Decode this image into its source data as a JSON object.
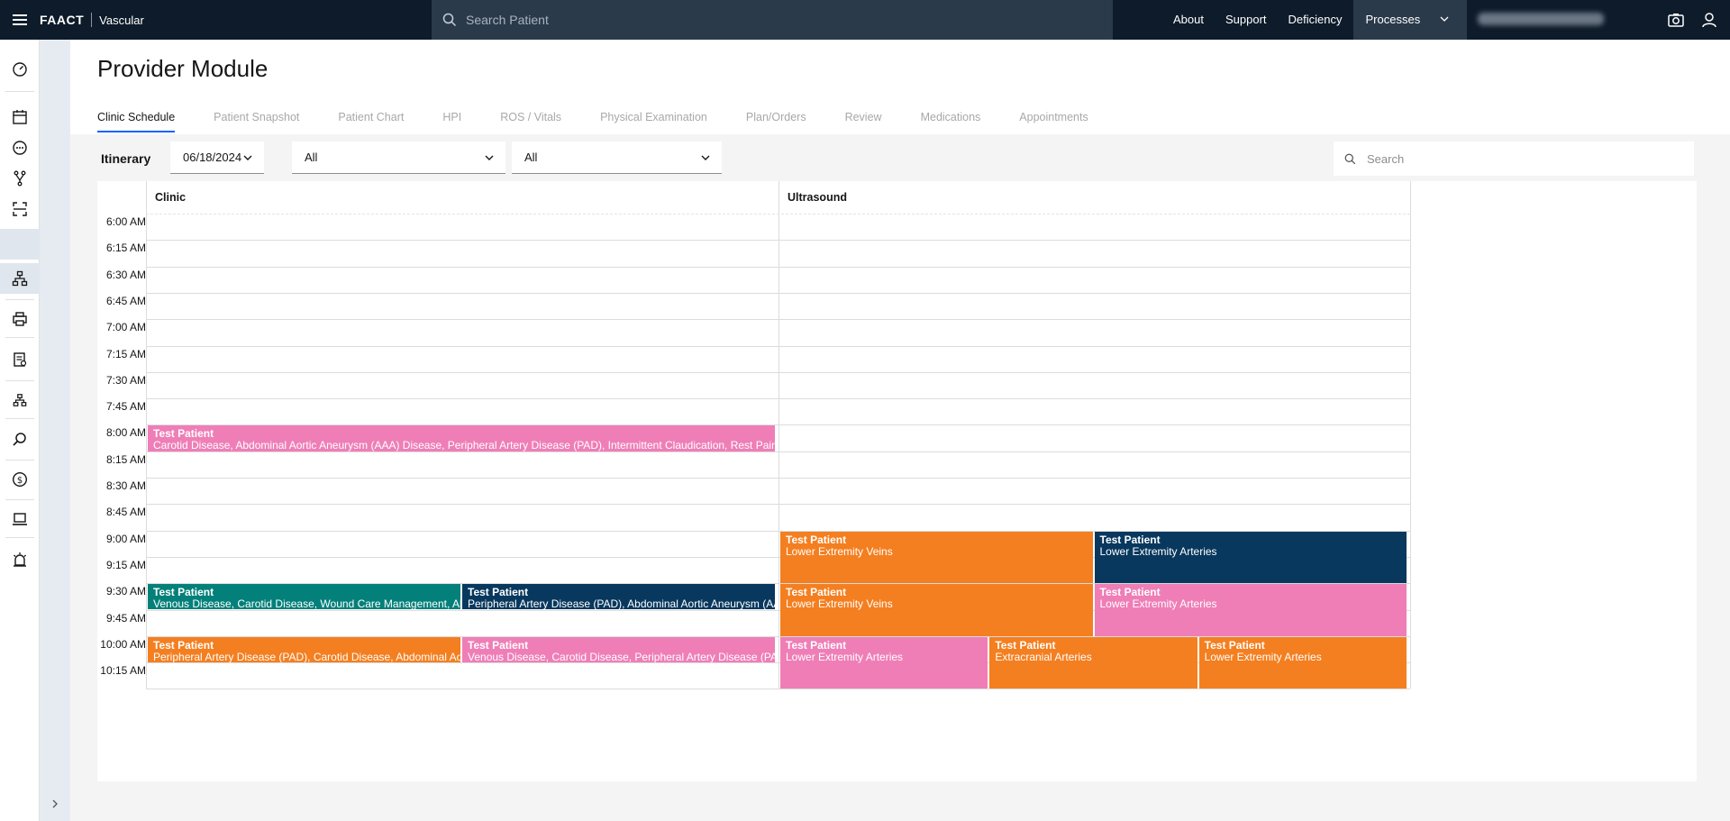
{
  "topbar": {
    "brand": "FAACT",
    "product": "Vascular",
    "search_placeholder": "Search Patient",
    "links": [
      "About",
      "Support",
      "Deficiency"
    ],
    "processes_label": "Processes",
    "icons": [
      "hamburger-icon",
      "search-icon",
      "chevron-down-icon",
      "camera-icon",
      "user-icon"
    ]
  },
  "rail": {
    "icons": [
      "dashboard-icon",
      "calendar-icon",
      "chat-icon",
      "branch-icon",
      "scan-icon",
      "lock-icon",
      "hierarchy-icon",
      "printer-icon",
      "report-icon",
      "org-chart-icon",
      "search-icon",
      "dollar-icon",
      "laptop-icon",
      "alarm-icon"
    ],
    "expand_icon": "chevron-right-icon"
  },
  "page": {
    "title": "Provider Module",
    "tabs": [
      "Clinic Schedule",
      "Patient Snapshot",
      "Patient Chart",
      "HPI",
      "ROS / Vitals",
      "Physical Examination",
      "Plan/Orders",
      "Review",
      "Medications",
      "Appointments"
    ],
    "active_tab": "Clinic Schedule"
  },
  "filters": {
    "itinerary_label": "Itinerary",
    "date": "06/18/2024",
    "filter1": "All",
    "filter2": "All",
    "search_placeholder": "Search"
  },
  "schedule": {
    "columns": [
      "Clinic",
      "Ultrasound"
    ],
    "times": [
      "6:00 AM",
      "6:15 AM",
      "6:30 AM",
      "6:45 AM",
      "7:00 AM",
      "7:15 AM",
      "7:30 AM",
      "7:45 AM",
      "8:00 AM",
      "8:15 AM",
      "8:30 AM",
      "8:45 AM",
      "9:00 AM",
      "9:15 AM",
      "9:30 AM",
      "9:45 AM",
      "10:00 AM",
      "10:15 AM"
    ],
    "appointments": [
      {
        "name": "Test Patient",
        "desc": "Carotid Disease, Abdominal Aortic Aneurysm (AAA) Disease, Peripheral Artery Disease (PAD), Intermittent Claudication, Rest Pain (CLI), Wound / Gangrene",
        "column": "Clinic",
        "start": "8:00 AM",
        "slots": 1,
        "color": "#ef7eb7"
      },
      {
        "name": "Test Patient",
        "desc": "Venous Disease, Carotid Disease, Wound Care Management, Abdominal Aortic Aneurysm (AAA) Disease",
        "column": "Clinic",
        "start": "9:30 AM",
        "slots": 1,
        "color": "#04807a"
      },
      {
        "name": "Test Patient",
        "desc": "Peripheral Artery Disease (PAD), Abdominal Aortic Aneurysm (AAA) Disease",
        "column": "Clinic",
        "start": "9:30 AM",
        "slots": 1,
        "color": "#08385e"
      },
      {
        "name": "Test Patient",
        "desc": "Peripheral Artery Disease (PAD), Carotid Disease, Abdominal Aortic Aneurysm (AAA) Disease",
        "column": "Clinic",
        "start": "10:00 AM",
        "slots": 1,
        "color": "#f47f20"
      },
      {
        "name": "Test Patient",
        "desc": "Venous Disease, Carotid Disease, Peripheral Artery Disease (PAD), Intermittent Claudication",
        "column": "Clinic",
        "start": "10:00 AM",
        "slots": 1,
        "color": "#ef7eb7"
      },
      {
        "name": "Test Patient",
        "desc": "Lower Extremity Veins",
        "column": "Ultrasound",
        "start": "9:00 AM",
        "slots": 2,
        "color": "#f47f20"
      },
      {
        "name": "Test Patient",
        "desc": "Lower Extremity Arteries",
        "column": "Ultrasound",
        "start": "9:00 AM",
        "slots": 2,
        "color": "#08385e"
      },
      {
        "name": "Test Patient",
        "desc": "Lower Extremity Veins",
        "column": "Ultrasound",
        "start": "9:30 AM",
        "slots": 2,
        "color": "#f47f20"
      },
      {
        "name": "Test Patient",
        "desc": "Lower Extremity Arteries",
        "column": "Ultrasound",
        "start": "9:30 AM",
        "slots": 2,
        "color": "#ef7eb7"
      },
      {
        "name": "Test Patient",
        "desc": "Lower Extremity Arteries",
        "column": "Ultrasound",
        "start": "10:00 AM",
        "slots": 2,
        "color": "#ef7eb7"
      },
      {
        "name": "Test Patient",
        "desc": "Extracranial Arteries",
        "column": "Ultrasound",
        "start": "10:00 AM",
        "slots": 2,
        "color": "#f47f20"
      },
      {
        "name": "Test Patient",
        "desc": "Lower Extremity Arteries",
        "column": "Ultrasound",
        "start": "10:00 AM",
        "slots": 2,
        "color": "#f47f20"
      }
    ]
  }
}
